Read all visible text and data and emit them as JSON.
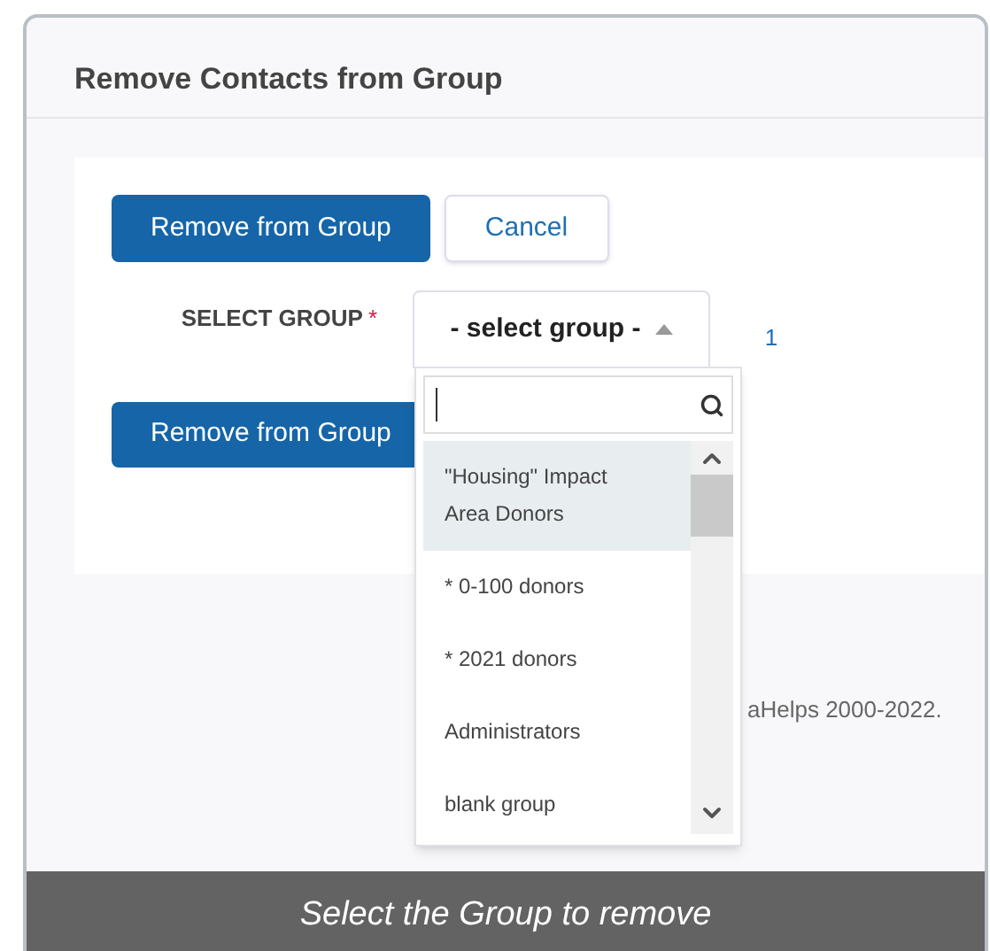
{
  "title": "Remove Contacts from Group",
  "buttons": [
    {
      "kind": "primary",
      "label": "Remove from Group"
    },
    {
      "kind": "secondary",
      "label": "Cancel"
    }
  ],
  "select_group": {
    "label": "SELECT GROUP",
    "required_mark": "*",
    "value": "- select group -",
    "expanded": true
  },
  "count": "1",
  "bottom_button": "Remove from Group",
  "footer": "aHelps 2000-2022.",
  "dropdown": {
    "options": [
      {
        "label": "\"Housing\" Impact Area Donors",
        "selected": true
      },
      {
        "label": "* 0-100 donors",
        "selected": false
      },
      {
        "label": "* 2021 donors",
        "selected": false
      },
      {
        "label": "Administrators",
        "selected": false
      },
      {
        "label": "blank group",
        "selected": false
      }
    ]
  },
  "caption": "Select the Group to remove"
}
